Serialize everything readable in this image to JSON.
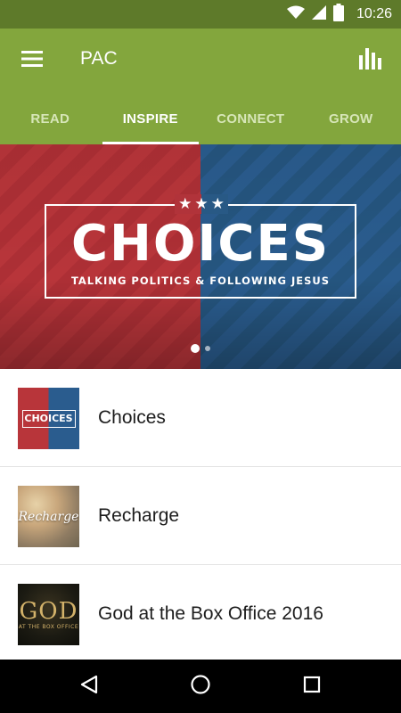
{
  "status_bar": {
    "time": "10:26",
    "icons": [
      "wifi-icon",
      "signal-icon",
      "battery-icon"
    ]
  },
  "app_bar": {
    "title": "PAC",
    "menu_icon": "hamburger-menu-icon",
    "action_icon": "bar-chart-icon"
  },
  "tabs": [
    {
      "label": "READ",
      "active": false
    },
    {
      "label": "INSPIRE",
      "active": true
    },
    {
      "label": "CONNECT",
      "active": false
    },
    {
      "label": "GROW",
      "active": false
    }
  ],
  "hero": {
    "title": "CHOICES",
    "subtitle": "TALKING POLITICS & FOLLOWING JESUS",
    "stars": "★★★",
    "carousel_pages": 2,
    "carousel_current": 1
  },
  "list": {
    "items": [
      {
        "label": "Choices",
        "thumb_text": "CHOICES"
      },
      {
        "label": "Recharge",
        "thumb_text": "Recharge"
      },
      {
        "label": "God at the Box Office 2016",
        "thumb_text": "GOD",
        "thumb_subtext": "AT THE BOX OFFICE"
      }
    ]
  },
  "colors": {
    "status_bar": "#5e7a2a",
    "app_bar": "#83a63d",
    "hero_red": "#b8353a",
    "hero_blue": "#2a5c8e",
    "nav_bar": "#000000"
  }
}
